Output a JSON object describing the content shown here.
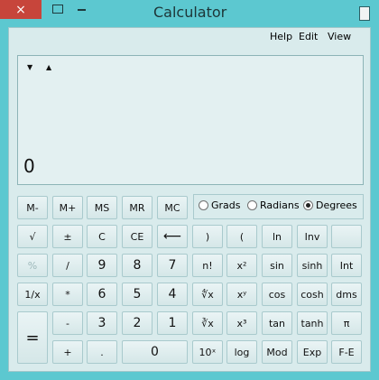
{
  "window": {
    "title": "Calculator",
    "close_label": "×"
  },
  "menu": {
    "view": "View",
    "edit": "Edit",
    "help": "Help"
  },
  "display": {
    "value": "0"
  },
  "angle_modes": {
    "degrees": "Degrees",
    "radians": "Radians",
    "grads": "Grads",
    "selected": "Degrees"
  },
  "buttons": {
    "mc": "MC",
    "mr": "MR",
    "ms": "MS",
    "mplus": "M+",
    "mminus": "M-",
    "inv": "Inv",
    "ln": "ln",
    "lparen": "(",
    "rparen": ")",
    "backspace": "⟵",
    "ce": "CE",
    "c": "C",
    "plusminus": "±",
    "sqrt": "√",
    "int": "Int",
    "sinh": "sinh",
    "sin": "sin",
    "xsq": "x²",
    "nfact": "n!",
    "seven": "7",
    "eight": "8",
    "nine": "9",
    "divide": "/",
    "percent": "%",
    "dms": "dms",
    "cosh": "cosh",
    "cos": "cos",
    "xpowy": "xʸ",
    "yrootx": "∜x",
    "four": "4",
    "five": "5",
    "six": "6",
    "multiply": "*",
    "reciprocal": "1/x",
    "pi": "π",
    "tanh": "tanh",
    "tan": "tan",
    "xcube": "x³",
    "cuberoot": "∛x",
    "one": "1",
    "two": "2",
    "three": "3",
    "minus": "-",
    "equals": "=",
    "fe": "F-E",
    "exp": "Exp",
    "mod": "Mod",
    "log": "log",
    "tenpow": "10ˣ",
    "zero": "0",
    "dot": ".",
    "plus": "+"
  },
  "colors": {
    "titlebar": "#5cc8d0",
    "close": "#c7453b",
    "client": "#d9ebec"
  }
}
